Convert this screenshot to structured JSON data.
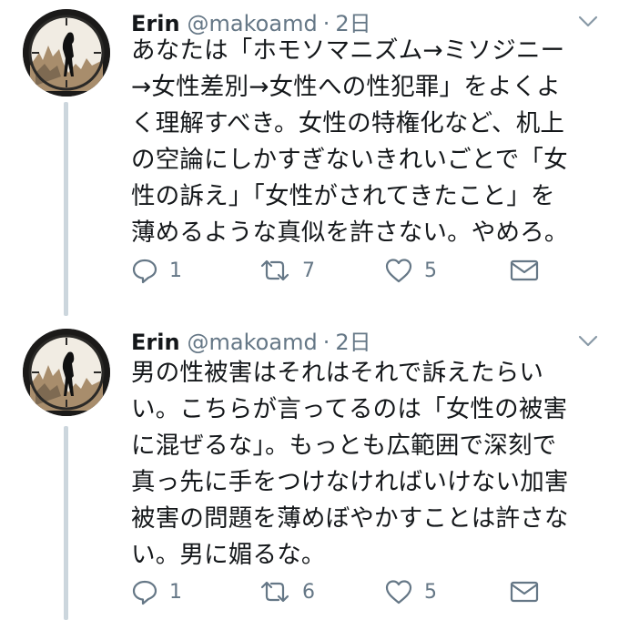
{
  "tweets": [
    {
      "name": "Erin",
      "handle": "@makoamd",
      "separator": "·",
      "time": "2日",
      "lines": [
        "あなたは「ホモソマニズム→ミソジニー",
        "→女性差別→女性への性犯罪」をよくよ",
        "く理解すべき。女性の特権化など、机上",
        "の空論にしかすぎないきれいごとで「女",
        "性の訴え」「女性がされてきたこと」を",
        "薄めるような真似を許さない。やめろ。"
      ],
      "reply_count": "1",
      "retweet_count": "7",
      "like_count": "5"
    },
    {
      "name": "Erin",
      "handle": "@makoamd",
      "separator": "·",
      "time": "2日",
      "lines": [
        "男の性被害はそれはそれで訴えたらい",
        "い。こちらが言ってるのは「女性の被害",
        "に混ぜるな」。もっとも広範囲で深刻で",
        "真っ先に手をつけなければいけない加害",
        "被害の問題を薄めぼやかすことは許さな",
        "い。男に媚るな。"
      ],
      "reply_count": "1",
      "retweet_count": "6",
      "like_count": "5"
    }
  ],
  "icons": {
    "reply": "reply-icon",
    "retweet": "retweet-icon",
    "like": "heart-icon",
    "dm": "envelope-icon",
    "menu": "chevron-down-icon"
  },
  "colors": {
    "text": "#14171a",
    "muted": "#657786",
    "thread_line": "#ccd6dd"
  }
}
